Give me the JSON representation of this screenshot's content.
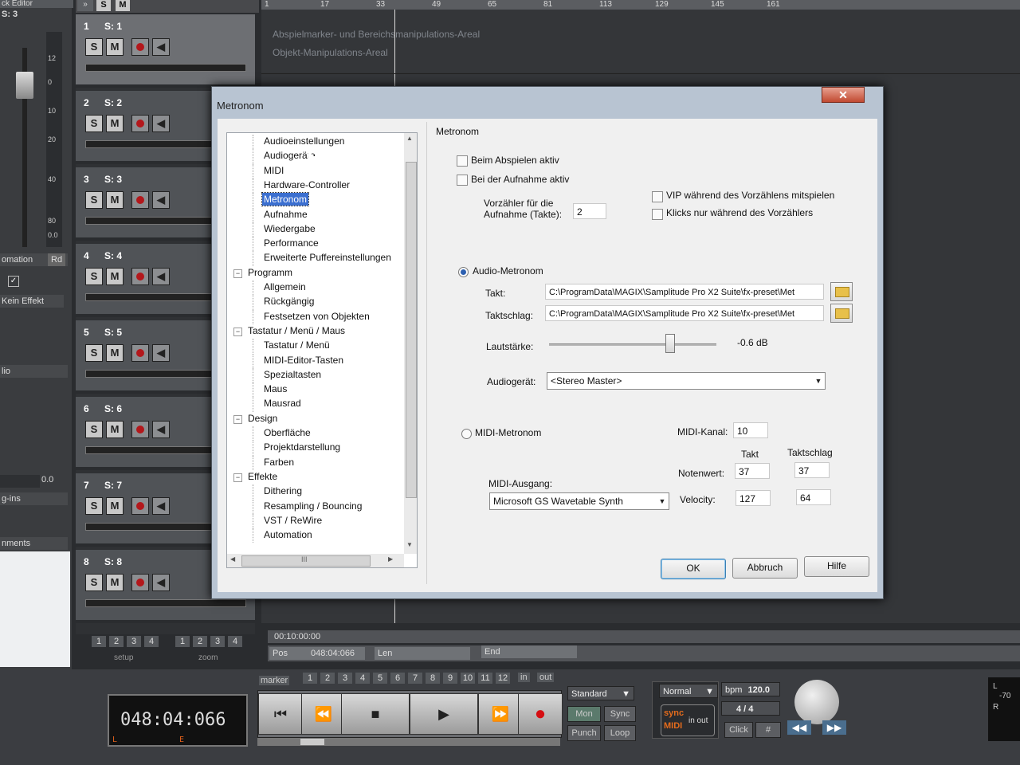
{
  "daw": {
    "left_panel": {
      "title": "ck Editor",
      "track_label": "S: 3",
      "automation_label": "omation",
      "rd_label": "Rd",
      "effect_label": "Kein Effekt",
      "plugins_label": "g-ins",
      "comments_label": "nments",
      "meter_ticks": [
        "12",
        "0",
        "10",
        "20",
        "40",
        "80",
        "0.0"
      ],
      "value_00": "0.0",
      "io_label": "lio"
    },
    "tracks": [
      {
        "num": "1",
        "name": "S: 1"
      },
      {
        "num": "2",
        "name": "S: 2"
      },
      {
        "num": "3",
        "name": "S: 3"
      },
      {
        "num": "4",
        "name": "S: 4"
      },
      {
        "num": "5",
        "name": "S: 5"
      },
      {
        "num": "6",
        "name": "S: 6"
      },
      {
        "num": "7",
        "name": "S: 7"
      },
      {
        "num": "8",
        "name": "S: 8"
      }
    ],
    "track_buttons": {
      "solo": "S",
      "mute": "M"
    },
    "ruler_marks": [
      "1",
      "17",
      "33",
      "49",
      "65",
      "81",
      "113",
      "129",
      "145",
      "161"
    ],
    "arrange_hints": [
      "Abspielmarker- und Bereichsmanipulations-Areal",
      "Objekt-Manipulations-Areal"
    ],
    "setup_label": "setup",
    "zoom_label": "zoom",
    "setup_nums": [
      "1",
      "2",
      "3",
      "4"
    ],
    "zoom_nums": [
      "1",
      "2",
      "3",
      "4"
    ],
    "time_top": "00:10:00:00",
    "pos_label": "Pos",
    "pos_value": "048:04:066",
    "len_label": "Len",
    "end_label": "End",
    "marker_label": "marker",
    "marker_nums": [
      "1",
      "2",
      "3",
      "4",
      "5",
      "6",
      "7",
      "8",
      "9",
      "10",
      "11",
      "12"
    ],
    "in_label": "in",
    "out_label": "out",
    "lcd_time": "048:04:066",
    "lcd_l": "L",
    "lcd_e": "E",
    "transport_symbols": [
      "⏮",
      "⏪",
      "■",
      "▶",
      "⏩",
      "●"
    ],
    "standard_label": "Standard",
    "mon_label": "Mon",
    "sync_label": "Sync",
    "punch_label": "Punch",
    "loop_label": "Loop",
    "normal_label": "Normal",
    "bpm_label": "bpm",
    "bpm_value": "120.0",
    "sig_value": "4 / 4",
    "click_label": "Click",
    "sync_small": "sync",
    "midi_small": "MIDI",
    "in_out_small": "in out",
    "meter_right": [
      "L",
      "-70",
      "R"
    ]
  },
  "dialog": {
    "title": "Metronom",
    "close_symbol": "✕",
    "tree": [
      {
        "label": "Audioeinstellungen",
        "level": 2
      },
      {
        "label": "Audiogeräte",
        "level": 2
      },
      {
        "label": "MIDI",
        "level": 2
      },
      {
        "label": "Hardware-Controller",
        "level": 2
      },
      {
        "label": "Metronom",
        "level": 2,
        "selected": true
      },
      {
        "label": "Aufnahme",
        "level": 2
      },
      {
        "label": "Wiedergabe",
        "level": 2
      },
      {
        "label": "Performance",
        "level": 2
      },
      {
        "label": "Erweiterte Puffereinstellungen",
        "level": 2
      },
      {
        "label": "Programm",
        "level": 1,
        "expander": "−"
      },
      {
        "label": "Allgemein",
        "level": 2
      },
      {
        "label": "Rückgängig",
        "level": 2
      },
      {
        "label": "Festsetzen von Objekten",
        "level": 2
      },
      {
        "label": "Tastatur / Menü / Maus",
        "level": 1,
        "expander": "−"
      },
      {
        "label": "Tastatur / Menü",
        "level": 2
      },
      {
        "label": "MIDI-Editor-Tasten",
        "level": 2
      },
      {
        "label": "Spezialtasten",
        "level": 2
      },
      {
        "label": "Maus",
        "level": 2
      },
      {
        "label": "Mausrad",
        "level": 2
      },
      {
        "label": "Design",
        "level": 1,
        "expander": "−"
      },
      {
        "label": "Oberfläche",
        "level": 2
      },
      {
        "label": "Projektdarstellung",
        "level": 2
      },
      {
        "label": "Farben",
        "level": 2
      },
      {
        "label": "Effekte",
        "level": 1,
        "expander": "−"
      },
      {
        "label": "Dithering",
        "level": 2
      },
      {
        "label": "Resampling / Bouncing",
        "level": 2
      },
      {
        "label": "VST / ReWire",
        "level": 2
      },
      {
        "label": "Automation",
        "level": 2
      }
    ],
    "section_title": "Metronom",
    "play_active_label": "Beim Abspielen aktiv",
    "record_active_label": "Bei der Aufnahme aktiv",
    "precount_label_1": "Vorzähler für die",
    "precount_label_2": "Aufnahme (Takte):",
    "precount_value": "2",
    "vip_label": "VIP während des Vorzählens mitspielen",
    "clicks_label": "Klicks nur während des Vorzählers",
    "audio_metronome_label": "Audio-Metronom",
    "takt_label": "Takt:",
    "takt_path": "C:\\ProgramData\\MAGIX\\Samplitude Pro X2 Suite\\fx-preset\\Met",
    "taktschlag_label": "Taktschlag:",
    "taktschlag_path": "C:\\ProgramData\\MAGIX\\Samplitude Pro X2 Suite\\fx-preset\\Met",
    "volume_label": "Lautstärke:",
    "volume_value": "-0.6 dB",
    "volume_level": 0.72,
    "audio_device_label": "Audiogerät:",
    "audio_device_value": "<Stereo Master>",
    "midi_metronome_label": "MIDI-Metronom",
    "midi_channel_label": "MIDI-Kanal:",
    "midi_channel_value": "10",
    "col_takt": "Takt",
    "col_taktschlag": "Taktschlag",
    "note_label": "Notenwert:",
    "note_takt": "37",
    "note_taktschlag": "37",
    "midi_out_label": "MIDI-Ausgang:",
    "midi_out_value": "Microsoft GS Wavetable Synth",
    "velocity_label": "Velocity:",
    "velocity_takt": "127",
    "velocity_taktschlag": "64",
    "ok_label": "OK",
    "cancel_label": "Abbruch",
    "help_label": "Hilfe",
    "scroll_up": "▲",
    "scroll_down": "▼",
    "scroll_left": "◀",
    "scroll_right": "▶",
    "hthumb_grip": "III",
    "combo_arrow": "▼"
  }
}
